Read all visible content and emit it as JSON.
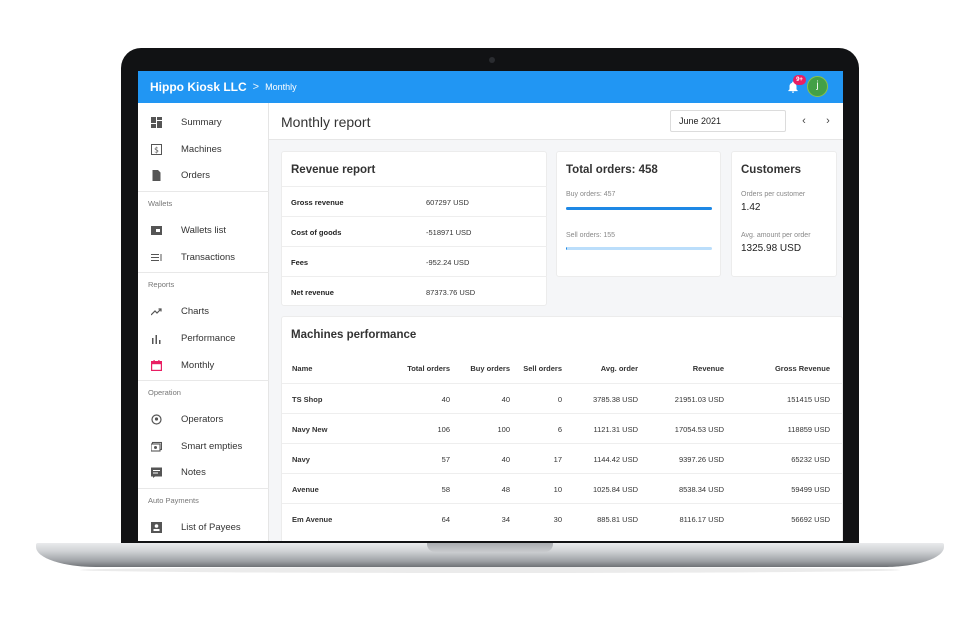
{
  "appbar": {
    "company": "Hippo Kiosk LLC",
    "separator": ">",
    "crumb": "Monthly",
    "notification_badge": "9+",
    "avatar_initial": "j",
    "accent_color": "#2196f3"
  },
  "sidebar": {
    "items_top": [
      {
        "label": "Summary",
        "icon": "dashboard-icon"
      },
      {
        "label": "Machines",
        "icon": "dollar-box-icon"
      },
      {
        "label": "Orders",
        "icon": "file-icon"
      }
    ],
    "section_wallets": "Wallets",
    "items_wallets": [
      {
        "label": "Wallets list",
        "icon": "wallet-icon"
      },
      {
        "label": "Transactions",
        "icon": "list-icon"
      }
    ],
    "section_reports": "Reports",
    "items_reports": [
      {
        "label": "Charts",
        "icon": "trend-icon"
      },
      {
        "label": "Performance",
        "icon": "bar-chart-icon"
      },
      {
        "label": "Monthly",
        "icon": "calendar-icon",
        "active_color": "#e91e63"
      }
    ],
    "section_operation": "Operation",
    "items_operation": [
      {
        "label": "Operators",
        "icon": "operator-icon"
      },
      {
        "label": "Smart empties",
        "icon": "smart-empties-icon"
      },
      {
        "label": "Notes",
        "icon": "notes-icon"
      }
    ],
    "section_auto": "Auto Payments",
    "items_auto": [
      {
        "label": "List of Payees",
        "icon": "payee-icon"
      }
    ]
  },
  "header": {
    "title": "Monthly report",
    "month": "June 2021",
    "prev": "‹",
    "next": "›"
  },
  "revenue": {
    "title": "Revenue report",
    "rows": [
      {
        "label": "Gross revenue",
        "value": "607297 USD"
      },
      {
        "label": "Cost of goods",
        "value": "-518971 USD"
      },
      {
        "label": "Fees",
        "value": "-952.24 USD"
      },
      {
        "label": "Net revenue",
        "value": "87373.76 USD"
      }
    ]
  },
  "orders": {
    "title": "Total orders: 458",
    "buy_label": "Buy orders: 457",
    "buy_fraction": 0.998,
    "sell_label": "Sell orders: 155",
    "sell_fraction": 0.01
  },
  "customers": {
    "title": "Customers",
    "per_customer_label": "Orders per customer",
    "per_customer_value": "1.42",
    "avg_label": "Avg. amount per order",
    "avg_value": "1325.98 USD"
  },
  "machines": {
    "title": "Machines performance",
    "columns": [
      "Name",
      "Total orders",
      "Buy orders",
      "Sell orders",
      "Avg. order",
      "Revenue",
      "Gross Revenue"
    ],
    "rows": [
      [
        "TS Shop",
        "40",
        "40",
        "0",
        "3785.38 USD",
        "21951.03 USD",
        "151415 USD"
      ],
      [
        "Navy New",
        "106",
        "100",
        "6",
        "1121.31 USD",
        "17054.53 USD",
        "118859 USD"
      ],
      [
        "Navy",
        "57",
        "40",
        "17",
        "1144.42 USD",
        "9397.26 USD",
        "65232 USD"
      ],
      [
        "Avenue",
        "58",
        "48",
        "10",
        "1025.84 USD",
        "8538.34 USD",
        "59499 USD"
      ],
      [
        "Em Avenue",
        "64",
        "34",
        "30",
        "885.81 USD",
        "8116.17 USD",
        "56692 USD"
      ]
    ]
  }
}
